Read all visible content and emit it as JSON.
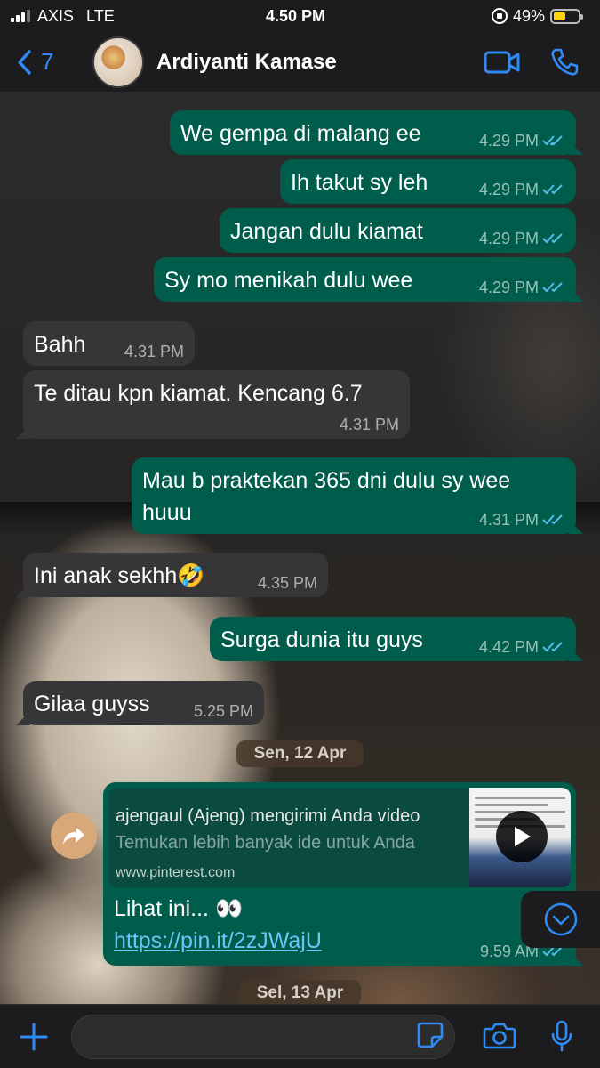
{
  "status_bar": {
    "carrier": "AXIS",
    "network": "LTE",
    "time": "4.50 PM",
    "battery": "49%",
    "battery_level": 0.49
  },
  "header": {
    "back_count": "7",
    "contact_name": "Ardiyanti Kamase"
  },
  "colors": {
    "accent": "#2f8cf6",
    "outgoing_bubble": "#005c4b",
    "incoming_bubble": "#363638",
    "read_ticks": "#53bdeb",
    "link": "#6bc6f5"
  },
  "messages": [
    {
      "direction": "out",
      "text": "We gempa di malang ee",
      "time": "4.29 PM",
      "status": "read"
    },
    {
      "direction": "out",
      "text": "Ih takut sy leh",
      "time": "4.29 PM",
      "status": "read"
    },
    {
      "direction": "out",
      "text": "Jangan dulu kiamat",
      "time": "4.29 PM",
      "status": "read"
    },
    {
      "direction": "out",
      "text": "Sy mo menikah dulu wee",
      "time": "4.29 PM",
      "status": "read"
    },
    {
      "direction": "in",
      "text": "Bahh",
      "time": "4.31 PM"
    },
    {
      "direction": "in",
      "text": "Te ditau kpn kiamat. Kencang 6.7",
      "time": "4.31 PM"
    },
    {
      "direction": "out",
      "text_line1": "Mau b praktekan 365 dni dulu sy wee",
      "text_line2": "huuu",
      "time": "4.31 PM",
      "status": "read"
    },
    {
      "direction": "in",
      "text": "Ini anak sekhh🤣",
      "time": "4.35 PM"
    },
    {
      "direction": "out",
      "text": "Surga dunia itu guys",
      "time": "4.42 PM",
      "status": "read"
    },
    {
      "direction": "in",
      "text": "Gilaa guyss",
      "time": "5.25 PM"
    }
  ],
  "date_separators": [
    "Sen, 12 Apr",
    "Sel, 13 Apr"
  ],
  "shared_message": {
    "direction": "out",
    "preview_title": "ajengaul (Ajeng) mengirimi Anda video",
    "preview_description": "Temukan lebih banyak ide untuk Anda",
    "preview_url": "www.pinterest.com",
    "text": "Lihat ini... 👀",
    "link": "https://pin.it/2zJWajU",
    "time": "9.59 AM",
    "status": "read"
  },
  "input": {
    "placeholder": "",
    "value": ""
  },
  "icons": {
    "back": "chevron-left-icon",
    "video_call": "video-camera-icon",
    "voice_call": "phone-icon",
    "forward": "forward-arrow-icon",
    "scroll_down": "chevron-down-circle-icon",
    "attach": "plus-icon",
    "sticker": "sticker-icon",
    "camera": "camera-icon",
    "mic": "microphone-icon"
  }
}
